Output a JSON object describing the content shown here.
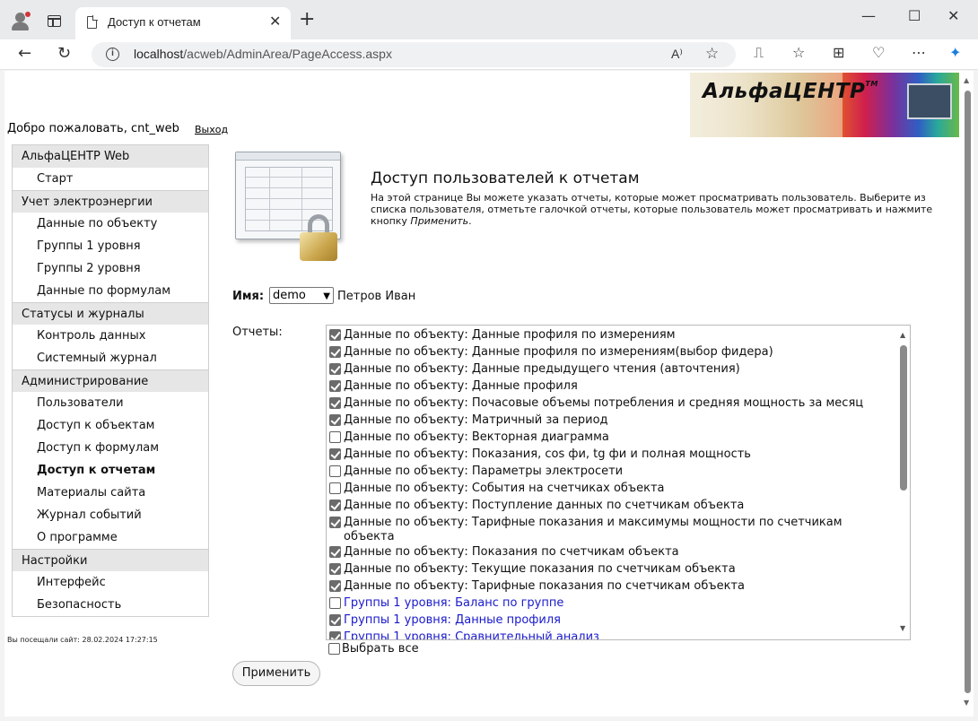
{
  "browser": {
    "tab_title": "Доступ к отчетам",
    "url_host": "localhost",
    "url_path": "/acweb/AdminArea/PageAccess.aspx",
    "close_glyph": "✕",
    "newtab_glyph": "+",
    "read_aloud": "A⁾",
    "window_controls": {
      "min": "—",
      "max": "☐",
      "close": "✕"
    },
    "nav": {
      "back": "←",
      "refresh": "↻",
      "info": "i",
      "star": "☆"
    },
    "tools": [
      "⎍",
      "☆",
      "⊞",
      "♡",
      "⋯",
      "✦"
    ]
  },
  "logo": {
    "text": "АльфаЦЕНТР",
    "tm": "TM"
  },
  "header": {
    "welcome": "Добро пожаловать, cnt_web",
    "logout": "Выход"
  },
  "sidebar": {
    "sections": [
      {
        "title": "АльфаЦЕНТР Web",
        "items": [
          "Старт"
        ]
      },
      {
        "title": "Учет электроэнергии",
        "items": [
          "Данные по объекту",
          "Группы 1 уровня",
          "Группы 2 уровня",
          "Данные по формулам"
        ]
      },
      {
        "title": "Статусы и журналы",
        "items": [
          "Контроль данных",
          "Системный журнал"
        ]
      },
      {
        "title": "Администрирование",
        "items": [
          "Пользователи",
          "Доступ к объектам",
          "Доступ к формулам",
          "Доступ к отчетам",
          "Материалы сайта",
          "Журнал событий",
          "О программе"
        ]
      },
      {
        "title": "Настройки",
        "items": [
          "Интерфейс",
          "Безопасность"
        ]
      }
    ],
    "active": "Доступ к отчетам"
  },
  "visited": "Вы посещали сайт: 28.02.2024 17:27:15",
  "page": {
    "title": "Доступ пользователей к отчетам",
    "description": "На этой странице Вы можете указать отчеты, которые может просматривать пользователь. Выберите из списка пользователя, отметьте галочкой отчеты, которые пользователь может просматривать и нажмите кнопку",
    "description_em": "Применить",
    "name_label": "Имя:",
    "user_select": "demo",
    "user_fullname": "Петров Иван",
    "reports_label": "Отчеты:",
    "reports": [
      {
        "label": "Данные по объекту: Данные профиля по измерениям",
        "checked": true,
        "blue": false
      },
      {
        "label": "Данные по объекту: Данные профиля по измерениям(выбор фидера)",
        "checked": true,
        "blue": false
      },
      {
        "label": "Данные по объекту: Данные предыдущего чтения (авточтения)",
        "checked": true,
        "blue": false
      },
      {
        "label": "Данные по объекту: Данные профиля",
        "checked": true,
        "blue": false
      },
      {
        "label": "Данные по объекту: Почасовые объемы потребления и средняя мощность за месяц",
        "checked": true,
        "blue": false
      },
      {
        "label": "Данные по объекту: Матричный за период",
        "checked": true,
        "blue": false
      },
      {
        "label": "Данные по объекту: Векторная диаграмма",
        "checked": false,
        "blue": false
      },
      {
        "label": "Данные по объекту: Показания, cos фи, tg фи и полная мощность",
        "checked": true,
        "blue": false
      },
      {
        "label": "Данные по объекту: Параметры электросети",
        "checked": false,
        "blue": false
      },
      {
        "label": "Данные по объекту: События на счетчиках объекта",
        "checked": false,
        "blue": false
      },
      {
        "label": "Данные по объекту: Поступление данных по счетчикам объекта",
        "checked": true,
        "blue": false
      },
      {
        "label": "Данные по объекту: Тарифные показания и максимумы мощности по счетчикам объекта",
        "checked": true,
        "blue": false,
        "wrap": true
      },
      {
        "label": "Данные по объекту: Показания по счетчикам объекта",
        "checked": true,
        "blue": false
      },
      {
        "label": "Данные по объекту: Текущие показания по счетчикам объекта",
        "checked": true,
        "blue": false
      },
      {
        "label": "Данные по объекту: Тарифные показания по счетчикам объекта",
        "checked": true,
        "blue": false
      },
      {
        "label": "Группы 1 уровня: Баланс по группе",
        "checked": false,
        "blue": true
      },
      {
        "label": "Группы 1 уровня: Данные профиля",
        "checked": true,
        "blue": true
      },
      {
        "label": "Группы 1 уровня: Сравнительный анализ",
        "checked": true,
        "blue": true
      }
    ],
    "select_all": "Выбрать все",
    "apply": "Применить"
  },
  "colors": {
    "link_blue": "#1a1acc",
    "header_gray": "#e6e6e6"
  }
}
